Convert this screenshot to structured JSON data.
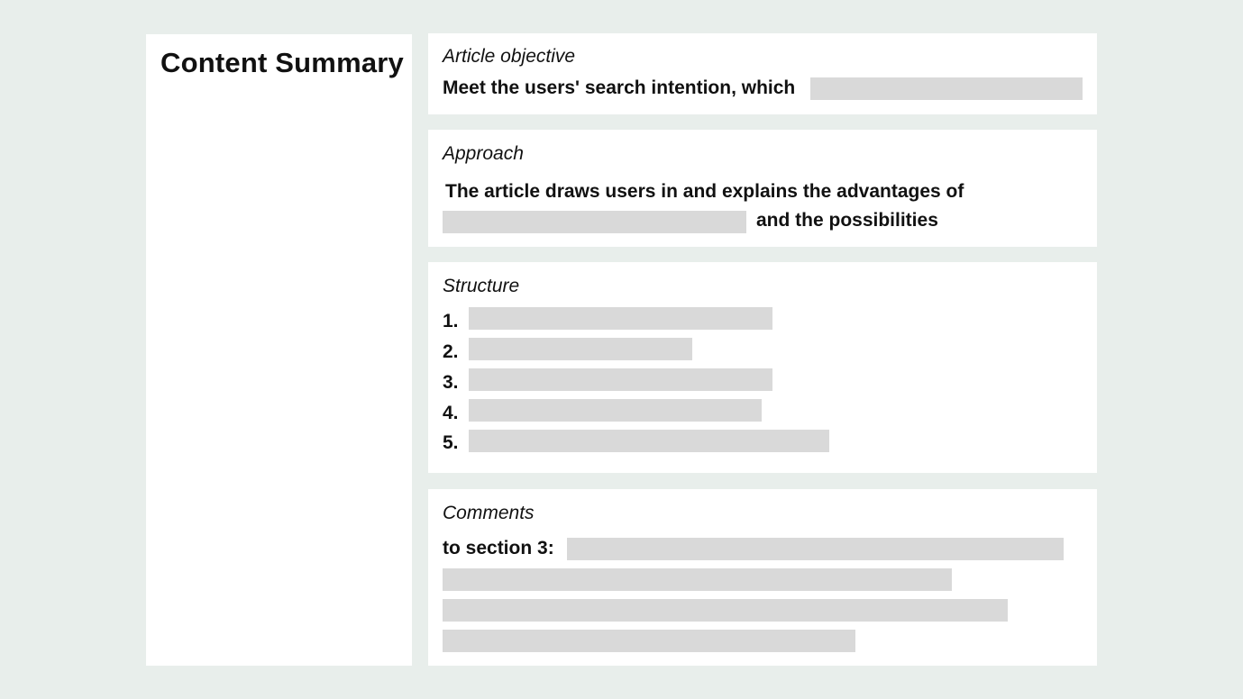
{
  "colors": {
    "background": "#e8eeeb",
    "panel": "#ffffff",
    "placeholder": "#d9d9d9",
    "text": "#111111"
  },
  "summary": {
    "title": "Content Summary"
  },
  "objective": {
    "label": "Article objective",
    "text": "Meet the users' search intention, which"
  },
  "approach": {
    "label": "Approach",
    "line1": "The article draws users in and explains the advantages of",
    "line2_suffix": "and the possibilities"
  },
  "structure": {
    "label": "Structure",
    "items": [
      {
        "number": "1."
      },
      {
        "number": "2."
      },
      {
        "number": "3."
      },
      {
        "number": "4."
      },
      {
        "number": "5."
      }
    ]
  },
  "comments": {
    "label": "Comments",
    "prefix": "to section 3:"
  }
}
